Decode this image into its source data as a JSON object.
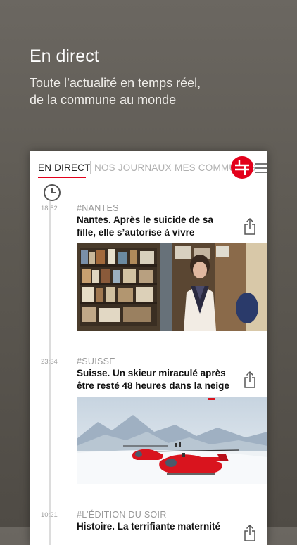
{
  "promo": {
    "title": "En direct",
    "subtitle_line1": "Toute l’actualité en temps réel,",
    "subtitle_line2": "de la commune au monde"
  },
  "app": {
    "tabs": [
      {
        "label": "EN DIRECT",
        "active": true
      },
      {
        "label": "NOS JOURNAUX",
        "active": false
      },
      {
        "label": "MES COMMUNES",
        "active": false
      }
    ],
    "accent_color": "#e3001b",
    "logo_icon": "newspaper-logo-icon",
    "menu_icon": "hamburger-menu-icon",
    "timeline_icon": "clock-icon",
    "articles": [
      {
        "time": "18:52",
        "tag": "#NANTES",
        "headline": "Nantes. Après le suicide de sa fille, elle s’autorise à vivre",
        "share_icon": "share-icon",
        "image": "woman-in-library-photo"
      },
      {
        "time": "23:34",
        "tag": "#SUISSE",
        "headline": "Suisse. Un skieur miraculé après être resté 48 heures dans la neige",
        "share_icon": "share-icon",
        "image": "rescue-helicopter-snow-photo"
      },
      {
        "time": "10:21",
        "tag": "#L’ÉDITION DU SOIR",
        "headline": "Histoire. La terrifiante maternité",
        "share_icon": "share-icon"
      }
    ]
  }
}
